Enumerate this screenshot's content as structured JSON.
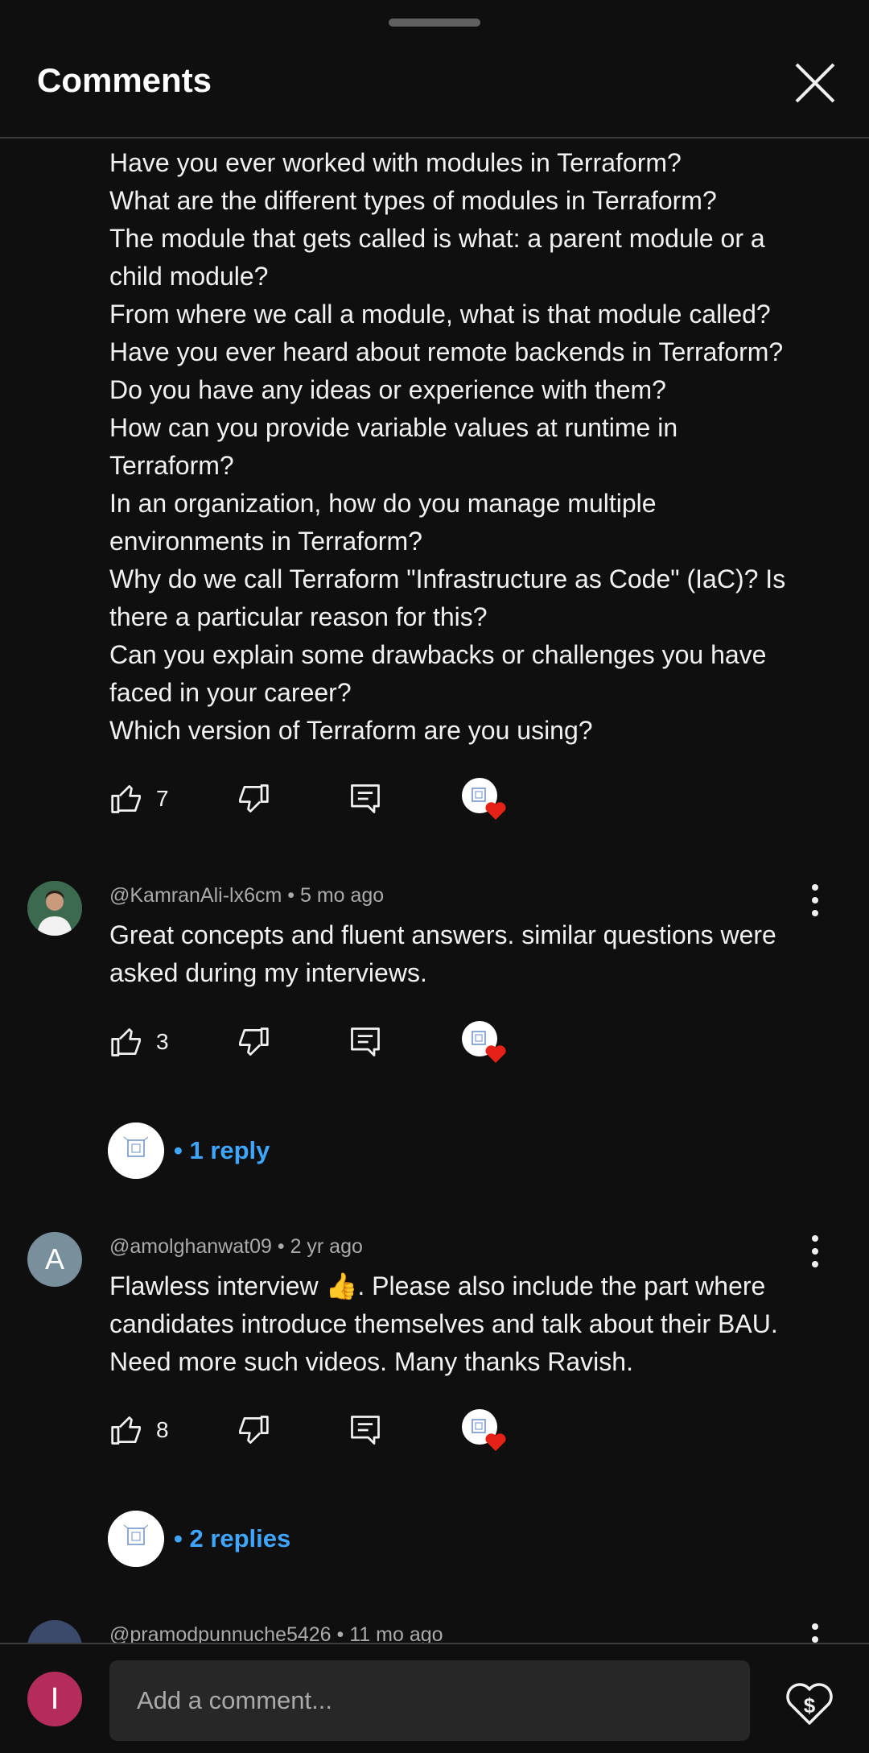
{
  "header": {
    "title": "Comments"
  },
  "comments": [
    {
      "lines": [
        "Have you ever worked with modules in Terraform?",
        "What are the different types of modules in Terraform?",
        "The module that gets called is what: a parent module or a",
        "child module?",
        "From where we call a module, what is that module called?",
        "Have you ever heard about remote backends in Terraform?",
        "Do you have any ideas or experience with them?",
        "How can you provide variable values at runtime in",
        "Terraform?",
        "In an organization, how do you manage multiple",
        "environments in Terraform?",
        "Why do we call Terraform \"Infrastructure as Code\" (IaC)? Is",
        "there a particular reason for this?",
        "Can you explain some drawbacks or challenges you have",
        "faced in your career?",
        "Which version of Terraform are you using?"
      ],
      "likes": "7"
    },
    {
      "author": "@KamranAli-lx6cm",
      "time": "5 mo ago",
      "lines": [
        "Great concepts and fluent answers.  similar questions were",
        "asked during my interviews."
      ],
      "likes": "3",
      "replies_label": "• 1 reply"
    },
    {
      "author": "@amolghanwat09",
      "avatar_letter": "A",
      "time": "2 yr ago",
      "lines": [
        "Flawless interview 👍. Please also include the part where",
        "candidates introduce themselves and talk about their BAU.",
        "Need more such videos. Many thanks Ravish."
      ],
      "likes": "8",
      "replies_label": "• 2 replies"
    },
    {
      "author": "@pramodpunnuche5426",
      "time": "11 mo ago"
    }
  ],
  "footer": {
    "user_initial": "I",
    "input_placeholder": "Add a comment..."
  },
  "colors": {
    "background": "#0f0f0f",
    "link_blue": "#3ea6ff",
    "heart_red": "#e62117",
    "user_avatar": "#b42c5c"
  }
}
